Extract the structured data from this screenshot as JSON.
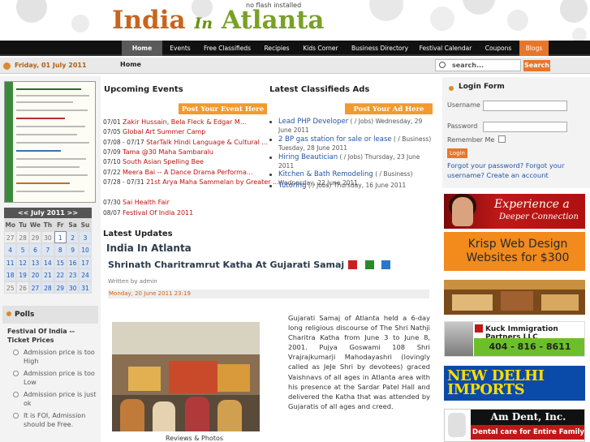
{
  "header": {
    "logo_india": "India",
    "logo_in": "In",
    "logo_atlanta": "Atlanta",
    "no_flash": "no flash installed"
  },
  "nav": {
    "items": [
      "Home",
      "Events",
      "Free Classifieds",
      "Recipies",
      "Kids Corner",
      "Business Directory",
      "Festival Calendar",
      "Coupons",
      "Blogs"
    ]
  },
  "subbar": {
    "date": "Friday, 01 July 2011",
    "breadcrumb": "Home",
    "search_placeholder": "search...",
    "search_button": "Search"
  },
  "calendar": {
    "header": "<< July 2011 >>",
    "days": [
      "Mo",
      "Tu",
      "We",
      "Th",
      "Fr",
      "Sa",
      "Su"
    ],
    "weeks": [
      [
        "27",
        "28",
        "29",
        "30",
        "1",
        "2",
        "3"
      ],
      [
        "4",
        "5",
        "6",
        "7",
        "8",
        "9",
        "10"
      ],
      [
        "11",
        "12",
        "13",
        "14",
        "15",
        "16",
        "17"
      ],
      [
        "18",
        "19",
        "20",
        "21",
        "22",
        "23",
        "24"
      ],
      [
        "25",
        "26",
        "27",
        "28",
        "29",
        "30",
        "31"
      ]
    ]
  },
  "polls": {
    "title": "Polls",
    "question": "Festival Of India -- Ticket Prices",
    "options": [
      "Admission price is too High",
      "Admission price is too Low",
      "Admission price is just ok",
      "It is FOI, Admission should be Free."
    ]
  },
  "events": {
    "title": "Upcoming Events",
    "post_button": "Post Your Event Here",
    "items": [
      {
        "date": "07/01",
        "name": "Zakir Hussain, Bela Fleck & Edgar M..."
      },
      {
        "date": "07/05",
        "name": "Global Art Summer Camp"
      },
      {
        "date": "07/08 - 07/17",
        "name": "StarTalk Hindi Language & Cultural ..."
      },
      {
        "date": "07/09",
        "name": "Tama @30 Maha Sambaralu"
      },
      {
        "date": "07/10",
        "name": "South Asian Spelling Bee"
      },
      {
        "date": "07/22",
        "name": "Meera Bai -- A Dance Drama Performa..."
      },
      {
        "date": "07/28 - 07/31",
        "name": "21st Arya Maha Sammelan by Greater ..."
      },
      {
        "date": "07/30",
        "name": "Sai Health Fair"
      },
      {
        "date": "08/07",
        "name": "Festival Of India 2011"
      }
    ]
  },
  "classifieds": {
    "title": "Latest Classifieds Ads",
    "post_button": "Post Your Ad Here",
    "items": [
      {
        "title": "Lead PHP Developer",
        "meta": "( / Jobs) Wednesday, 29 June 2011"
      },
      {
        "title": "2 BP gas station for sale or lease",
        "meta": "( / Business) Tuesday, 28 June 2011"
      },
      {
        "title": "Hiring Beautician",
        "meta": "( / Jobs) Thursday, 23 June 2011"
      },
      {
        "title": "Kitchen & Bath Remodeling",
        "meta": "( / Business) Wednesday, 22 June 2011"
      },
      {
        "title": "Tutoring",
        "meta": "( / Jobs) Thursday, 16 June 2011"
      }
    ]
  },
  "updates": {
    "title": "Latest Updates",
    "section": "India In Atlanta",
    "article_title": "Shrinath Charitramrut Katha At Gujarati Samaj",
    "written_by": "Written by admin",
    "date": "Monday, 20 June 2011 23:19",
    "photo_caption": "Reviews & Photos",
    "body": "Gujarati Samaj of Atlanta held a 6-day long religious discourse of The Shri Nathji Charitra Katha from June 3 to June 8, 2001. Pujya Goswami 108 Shri Vrajrajkumarji Mahodayashri (lovingly called as JeJe Shri by devotees) graced Vaishnavs of all ages in Atlanta area with his presence at the Sardar Patel Hall and delivered the Katha that was attended by Gujaratis of all ages and creed."
  },
  "login": {
    "title": "Login Form",
    "username_label": "Username",
    "password_label": "Password",
    "remember_label": "Remember Me",
    "button": "Login",
    "links": "Forgot your password? Forgot your username? Create an account"
  },
  "ads": {
    "ad1_line1": "Experience a",
    "ad1_line2": "Deeper Connection",
    "ad2_line1": "Krisp Web Design",
    "ad2_line2": "Websites for $300",
    "ad4_title": "Kuck Immigration Partners LLC",
    "ad4_phone": "404 - 816 - 8611",
    "ad5_line1": "NEW DELHI IMPORTS",
    "ad6_title": "Am Dent, Inc.",
    "ad6_sub": "Dental care for Entire Family"
  }
}
